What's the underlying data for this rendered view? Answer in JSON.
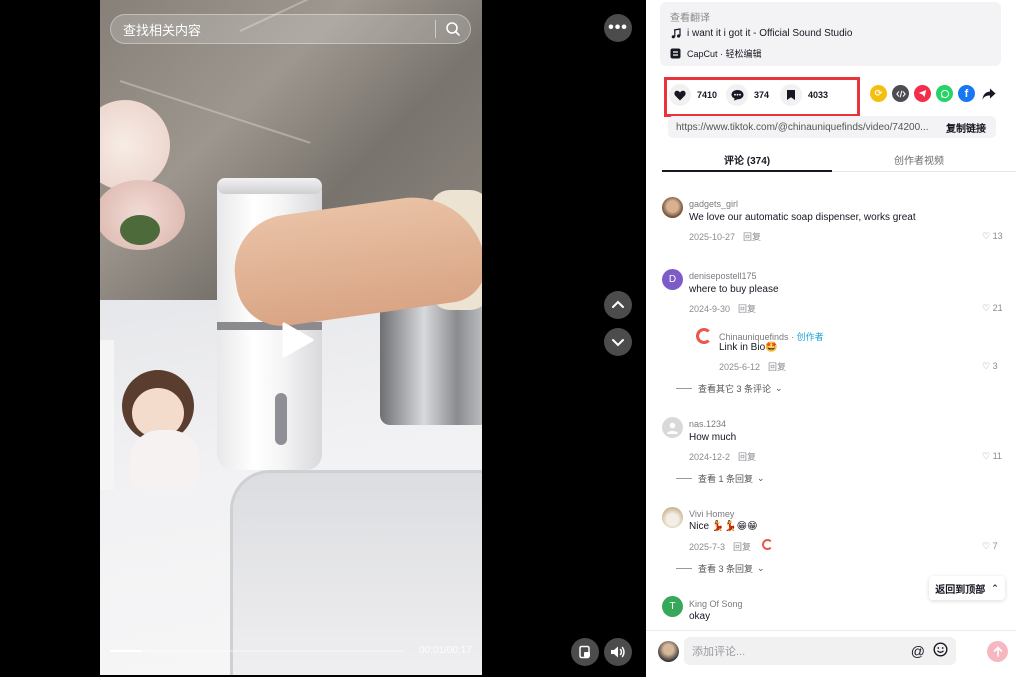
{
  "video": {
    "search_placeholder": "查找相关内容",
    "time": "00:01/00:17",
    "progress": 0.11
  },
  "info": {
    "translate": "查看翻译",
    "music": "i want it i got it - Official Sound Studio",
    "capcut": "CapCut · 轻松编辑"
  },
  "actions": {
    "likes": "7410",
    "comments": "374",
    "saves": "4033"
  },
  "share_icons": [
    "repost-icon",
    "embed-icon",
    "telegram-icon",
    "whatsapp-icon",
    "facebook-icon",
    "share-arrow-icon"
  ],
  "link": {
    "url": "https://www.tiktok.com/@chinauniquefinds/video/74200...",
    "copy_label": "复制链接"
  },
  "tabs": {
    "comments": "评论 (374)",
    "creator_videos": "创作者视频"
  },
  "comments": [
    {
      "user": "gadgets_girl",
      "text": "We love our automatic soap dispenser, works great",
      "date": "2025-10-27",
      "reply": "回复",
      "likes": "13"
    },
    {
      "user": "denisepostell175",
      "text": "where to buy please",
      "date": "2024-9-30",
      "reply": "回复",
      "likes": "21",
      "avatar_letter": "D"
    },
    {
      "user": "Chinauniquefinds",
      "creator": "创作者",
      "text": "Link in Bio🤩",
      "date": "2025-6-12",
      "reply": "回复",
      "likes": "3",
      "sep": " · "
    },
    {
      "user": "nas.1234",
      "text": "How much",
      "date": "2024-12-2",
      "reply": "回复",
      "likes": "11"
    },
    {
      "user": "Vivi Homey",
      "text": "Nice 💃💃😁😁",
      "date": "2025-7-3",
      "reply": "回复",
      "likes": "7"
    },
    {
      "user": "King Of Song",
      "text": "okay",
      "avatar_letter": "T"
    }
  ],
  "more_replies": [
    "查看其它 3 条评论",
    "查看 1 条回复",
    "查看 3 条回复"
  ],
  "back_top": "返回到顶部",
  "composer": {
    "placeholder": "添加评论...",
    "at": "@"
  },
  "colors": {
    "highlight": "#e8343b",
    "avatar_purple": "#7d5cc7",
    "avatar_green": "#37a859",
    "creator": "#1ea2d6"
  }
}
